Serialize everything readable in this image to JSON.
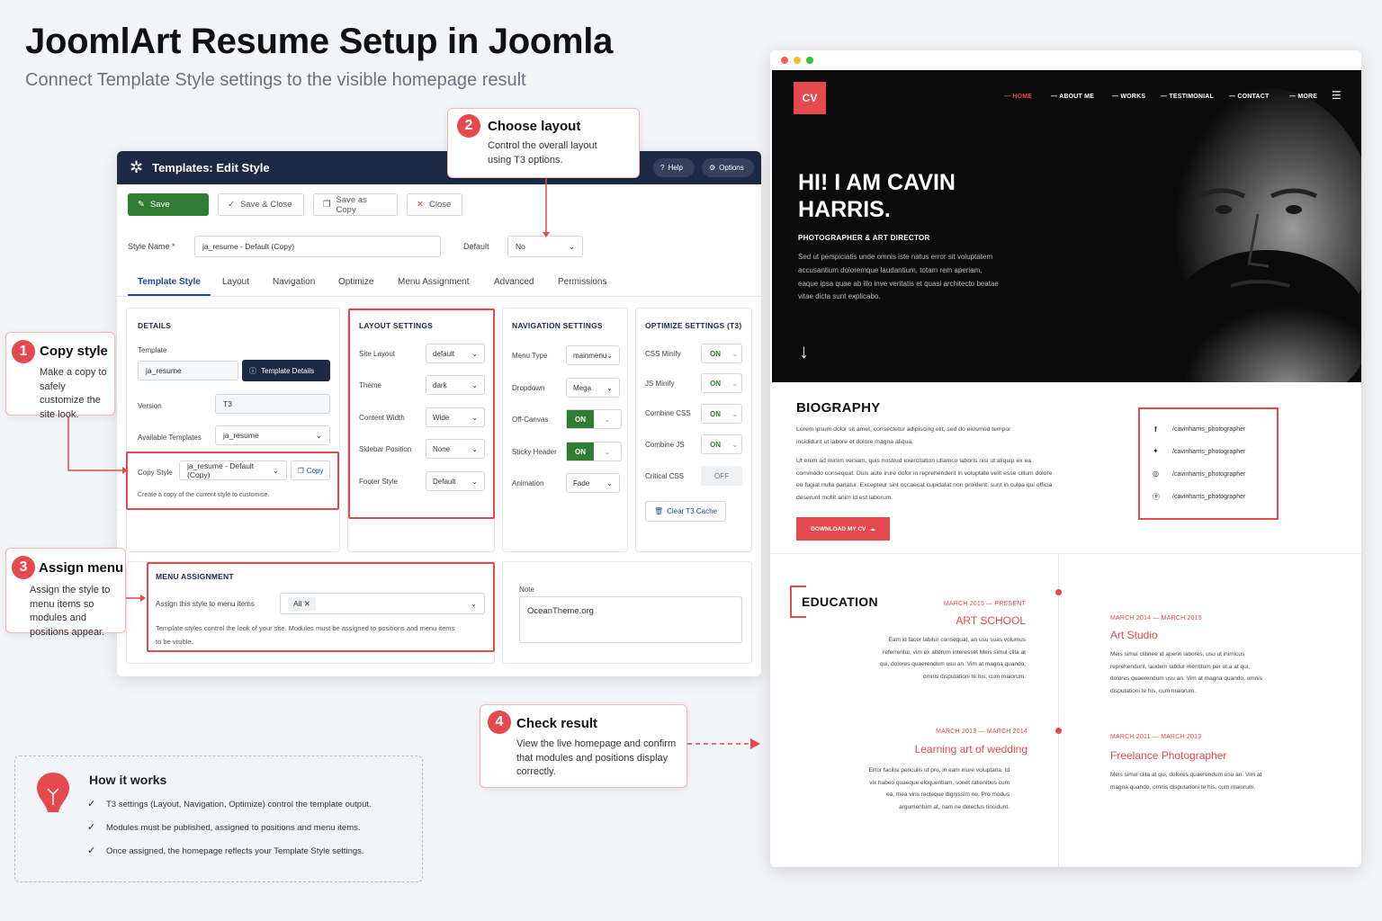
{
  "page": {
    "title": "JoomlArt Resume Setup in Joomla",
    "subtitle": "Connect Template Style settings to the visible homepage result"
  },
  "admin": {
    "header": "Templates: Edit Style",
    "help": "Help",
    "options": "Options",
    "toolbar": {
      "save": "Save",
      "save_close": "Save & Close",
      "save_copy": "Save as Copy",
      "close": "Close"
    },
    "style_name_label": "Style Name *",
    "style_name_value": "ja_resume - Default (Copy)",
    "default_label": "Default",
    "default_value": "No",
    "tabs": [
      "Template Style",
      "Layout",
      "Navigation",
      "Optimize",
      "Menu Assignment",
      "Advanced",
      "Permissions"
    ],
    "details": {
      "heading": "DETAILS",
      "template_label": "Template",
      "template_value": "ja_resume",
      "template_details_btn": "Template Details",
      "version_label": "Version",
      "version_value": "T3",
      "available_label": "Available Templates",
      "available_value": "ja_resume",
      "copy_style_label": "Copy Style",
      "copy_style_value": "ja_resume - Default (Copy)",
      "copy_btn": "Copy",
      "copy_help": "Create a copy of the current style to customise."
    },
    "layout": {
      "heading": "LAYOUT SETTINGS",
      "rows": [
        {
          "label": "Site Layout",
          "value": "default"
        },
        {
          "label": "Theme",
          "value": "dark"
        },
        {
          "label": "Content Width",
          "value": "Wide"
        },
        {
          "label": "Sidebar Position",
          "value": "None"
        },
        {
          "label": "Footer Style",
          "value": "Default"
        }
      ]
    },
    "navigation": {
      "heading": "NAVIGATION SETTINGS",
      "menu_type_label": "Menu Type",
      "menu_type_value": "mainmenu",
      "dropdown_label": "Dropdown",
      "dropdown_value": "Mega",
      "offcanvas_label": "Off-Canvas",
      "offcanvas_value": "ON",
      "sticky_label": "Sticky Header",
      "sticky_value": "ON",
      "animation_label": "Animation",
      "animation_value": "Fade"
    },
    "optimize": {
      "heading": "OPTIMIZE SETTINGS (T3)",
      "css_minify_label": "CSS Minify",
      "css_minify_value": "ON",
      "js_minify_label": "JS Minify",
      "js_minify_value": "ON",
      "combine_css_label": "Combine CSS",
      "combine_css_value": "ON",
      "combine_js_label": "Combine JS",
      "combine_js_value": "ON",
      "critical_css_label": "Critical CSS",
      "critical_css_value": "OFF",
      "clear_cache_btn": "Clear T3 Cache"
    },
    "menu_assignment": {
      "heading": "MENU ASSIGNMENT",
      "assign_label": "Assign this style to menu items",
      "assign_value": "All",
      "help": "Template styles control the look of your site. Modules must be assigned to positions and menu items to be visible."
    },
    "note": {
      "label": "Note",
      "value": "OceanTheme.org"
    }
  },
  "callouts": [
    {
      "num": "1",
      "title": "Copy style",
      "desc": "Make a copy to safely customize the site look."
    },
    {
      "num": "2",
      "title": "Choose layout",
      "desc": "Control the overall layout using T3 options."
    },
    {
      "num": "3",
      "title": "Assign menu",
      "desc": "Assign the style to menu items so modules and positions appear."
    },
    {
      "num": "4",
      "title": "Check result",
      "desc": "View the live homepage and confirm that modules and positions display correctly."
    }
  ],
  "how": {
    "title": "How it works",
    "items": [
      "T3 settings (Layout, Navigation, Optimize) control the template output.",
      "Modules must be published, assigned to positions and menu items.",
      "Once assigned, the homepage reflects your Template Style settings."
    ]
  },
  "site": {
    "logo": "CV",
    "nav": [
      "HOME",
      "ABOUT ME",
      "WORKS",
      "TESTIMONIAL",
      "CONTACT",
      "MORE"
    ],
    "hero_title_1": "HI! I AM CAVIN",
    "hero_title_2": "HARRIS.",
    "hero_role": "PHOTOGRAPHER & ART DIRECTOR",
    "hero_text": "Sed ut perspiciatis unde omnis iste natus error sit voluptatem accusantium doloremque laudantium, totam rem aperiam, eaque ipsa quae ab illo inve veritatis et quasi architecto beatae vitae dicta sunt explicabo.",
    "bio_heading": "BIOGRAPHY",
    "bio_p1": "Lorem ipsum dolor sit amet, consectetur adipiscing elit, sed do eiusmod tempor incididunt ut labore et dolore magna aliqua.",
    "bio_p2": "Ut enim ad minim veniam, quis nostrud exercitation ullamco laboris nisi ut aliquip ex ea commodo consequat. Duis aute irure dolor in reprehenderit in voluptate velit esse cillum dolore eu fugiat nulla pariatur. Excepteur sint occaecat cupidatat non proident, sunt in culpa qui officia deserunt mollit anim id est laborum.",
    "download_btn": "DOWNLOAD MY CV",
    "social": [
      "/cavinharris_photographer",
      "/cavinharris_photographer",
      "/cavinharris_photographer",
      "/cavinharris_photographer"
    ],
    "education_heading": "EDUCATION",
    "edu": [
      {
        "date": "MARCH 2015 — PRESENT",
        "title": "ART SCHOOL",
        "text": "Eam id facer labitur consequat, an usu suas volumus referrentur, vim ex alterum interesset Meis simul clita at qui, dolores quaerendum usu an. Vim at magna quando, omnis disputationi te his, cum maiorum."
      },
      {
        "date": "MARCH 2014 — MARCH 2015",
        "title": "Art Studio",
        "text": "Meis simul clitinee id aperiri labores, usu ut inimicus reprehendunt, laudem labitur mentitum per ut.a at qui, dolores quaerendum usu an. Vim at magna quando, omnis disputationi te his, cum maiorum."
      },
      {
        "date": "MARCH 2013 — MARCH 2014",
        "title": "Learning art of wedding",
        "text": "Error facilisi periculis ut pro, in eam iriure voluptaria. Id vix habeo quaeque eloquentiam, sonet rationibus cum ea, mea viris recteque dignissim ne. Pro modus argumentum at, nam ne delectus tincidunt."
      },
      {
        "date": "MARCH 2011 — MARCH 2013",
        "title": "Freelance Photographer",
        "text": "Meis simul clita at qui, dolores quaerendum usu an. Vim at magna quando, omnis disputationi te his, cum maiorum."
      }
    ]
  },
  "colors": {
    "accent": "#e5484d",
    "admin_header": "#1d2a46",
    "save_green": "#2f7d32"
  }
}
